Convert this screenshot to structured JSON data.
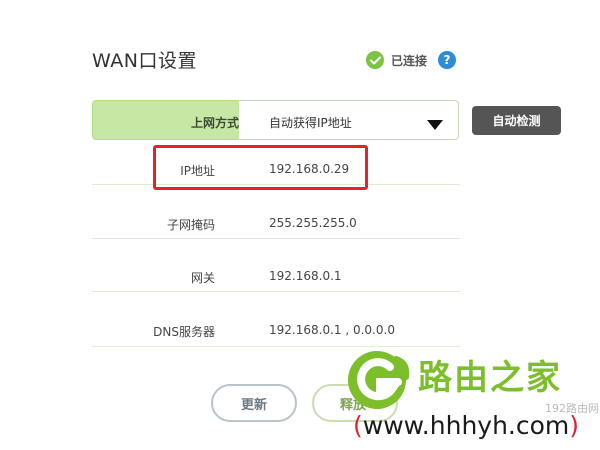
{
  "header": {
    "title": "WAN口设置",
    "status_text": "已连接",
    "help_icon_text": "?"
  },
  "wan": {
    "label": "上网方式",
    "selected": "自动获得IP地址",
    "detect_button": "自动检测"
  },
  "fields": [
    {
      "label": "IP地址",
      "value": "192.168.0.29"
    },
    {
      "label": "子网掩码",
      "value": "255.255.255.0"
    },
    {
      "label": "网关",
      "value": "192.168.0.1"
    },
    {
      "label": "DNS服务器",
      "value": "192.168.0.1 , 0.0.0.0"
    }
  ],
  "buttons": {
    "refresh": "更新",
    "release": "释放"
  },
  "watermark": {
    "brand": "路由之家",
    "small": "192路由网",
    "url_open": "(",
    "url": "www.hhhyh.com",
    "url_close": ")"
  },
  "colors": {
    "accent_green": "#7cc243",
    "wan_label_bg": "#c7e8a5",
    "detect_button_bg": "#555555",
    "highlight_red": "#e0242b",
    "help_blue": "#2e8bd6"
  },
  "icons": {
    "status": "check-circle-icon",
    "help": "question-circle-icon",
    "dropdown": "caret-down-icon"
  }
}
